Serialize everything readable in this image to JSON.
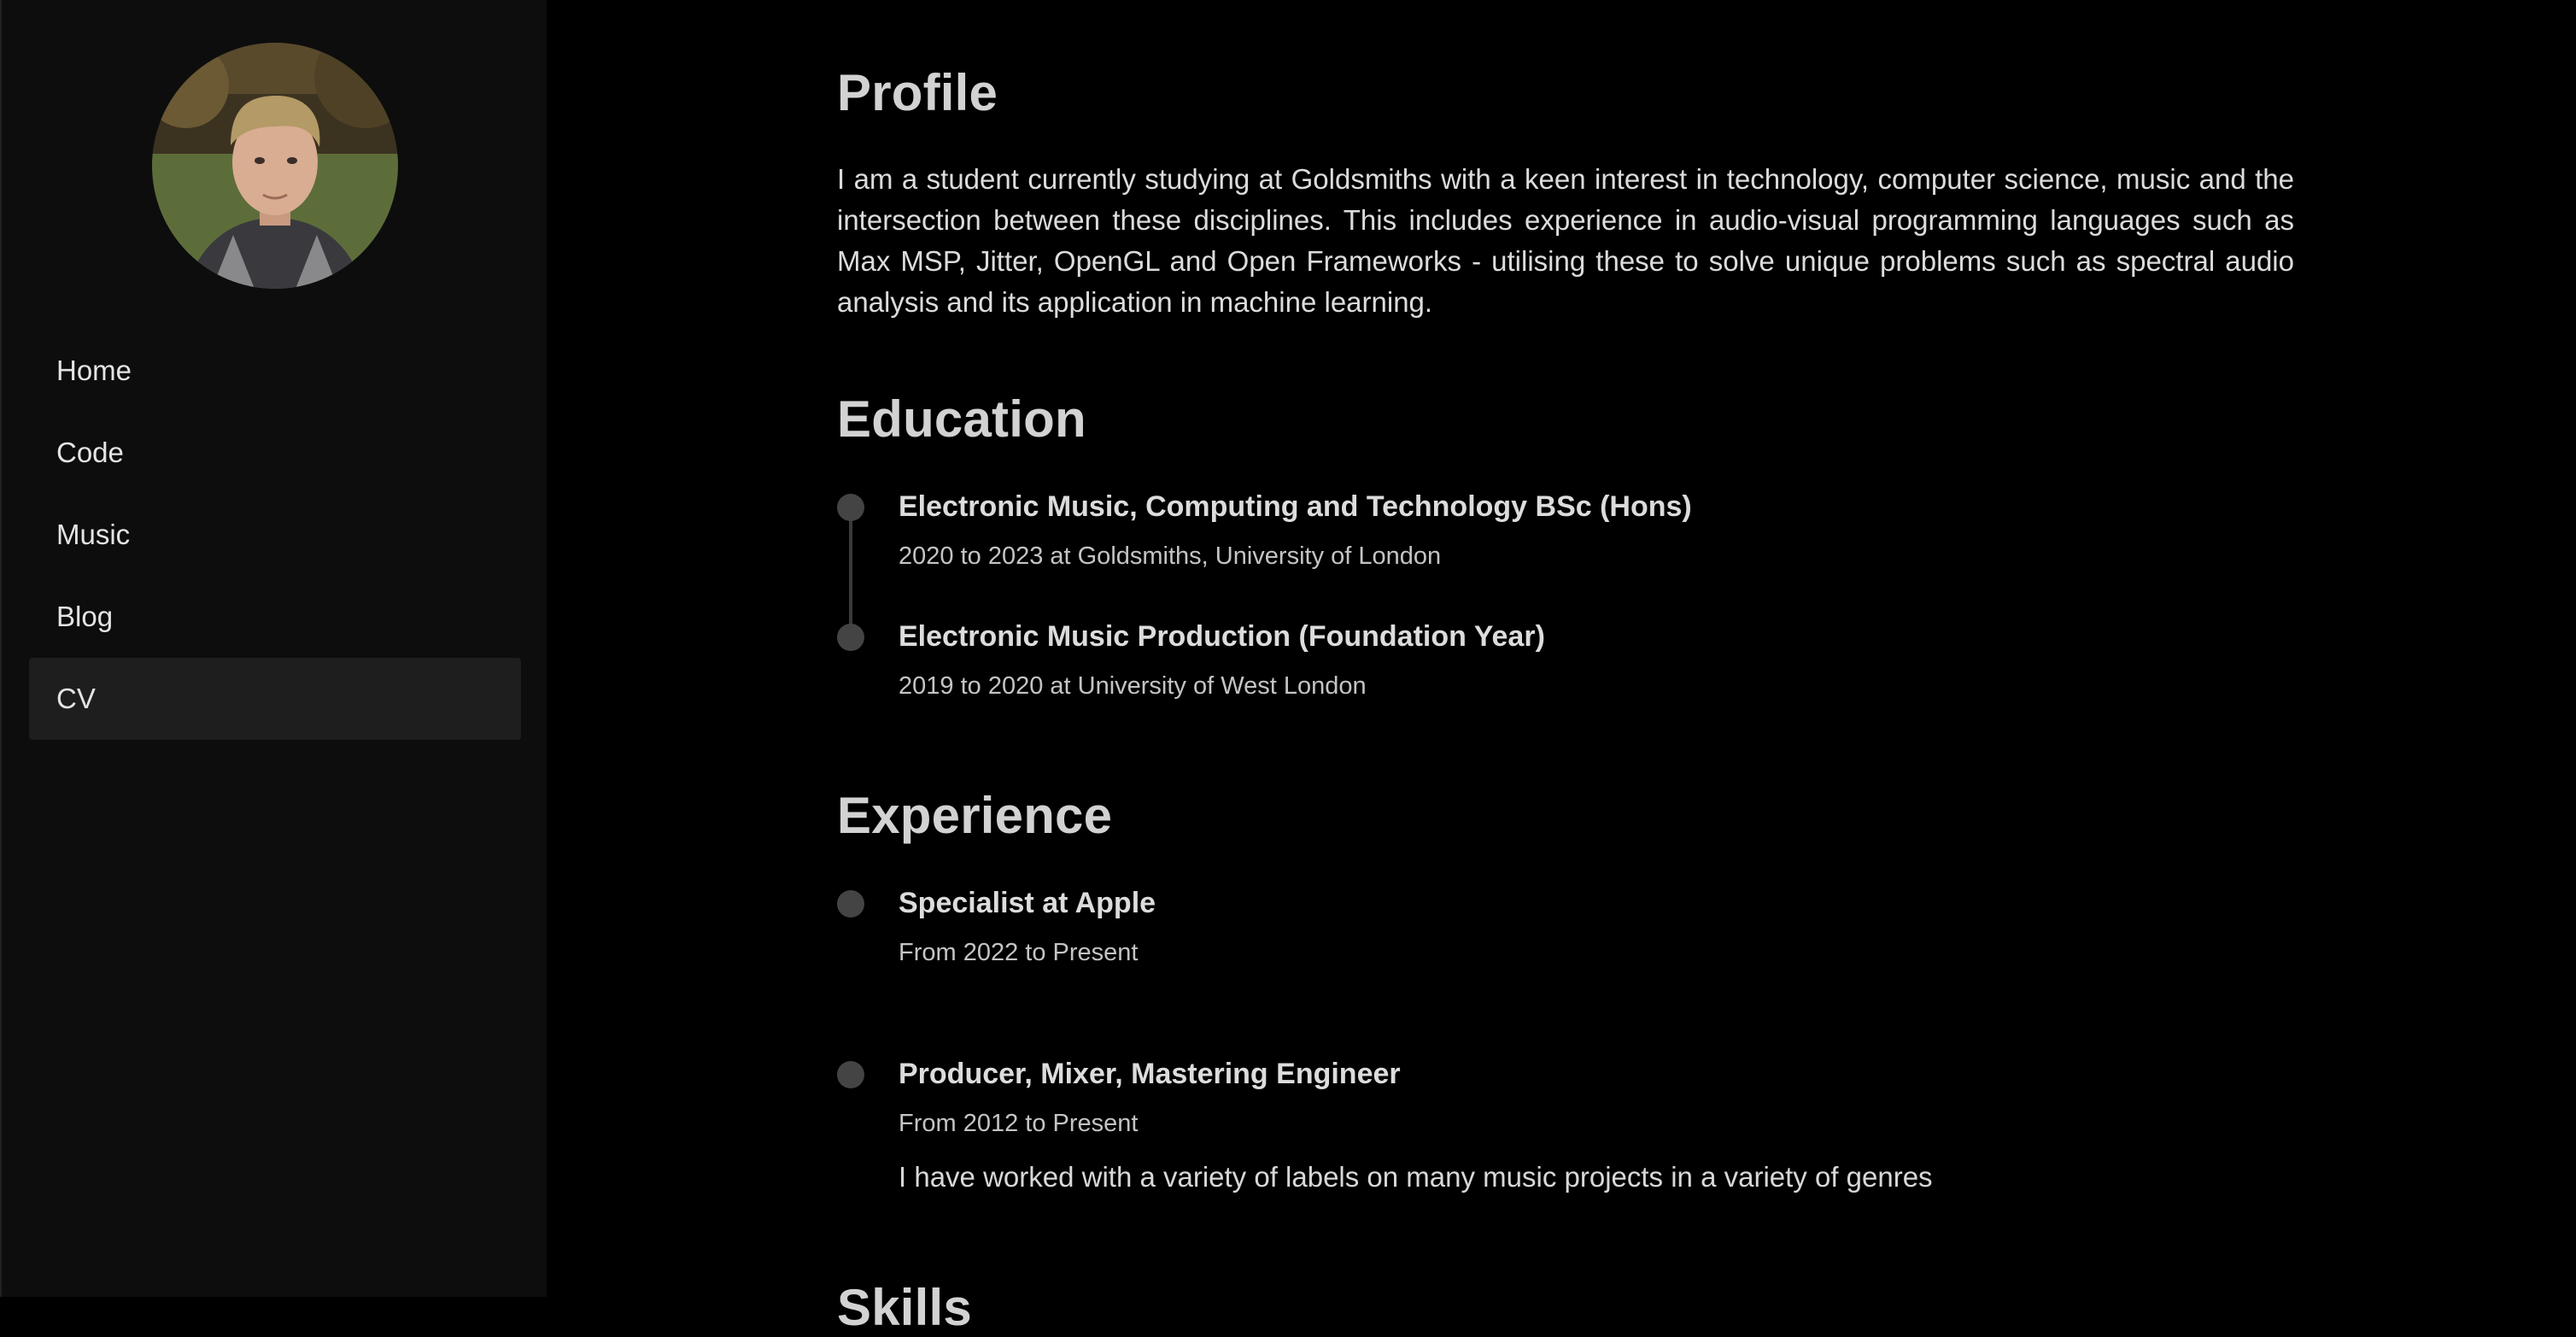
{
  "sidebar": {
    "nav": [
      {
        "label": "Home"
      },
      {
        "label": "Code"
      },
      {
        "label": "Music"
      },
      {
        "label": "Blog"
      },
      {
        "label": "CV",
        "active": true
      }
    ]
  },
  "profile": {
    "heading": "Profile",
    "text": "I am a student currently studying at Goldsmiths with a keen interest in technology, computer science, music and the intersection between these disciplines. This includes experience in audio-visual programming languages such as Max MSP, Jitter, OpenGL and Open Frameworks - utilising these to solve unique problems such as spectral audio analysis and its application in machine learning."
  },
  "education": {
    "heading": "Education",
    "items": [
      {
        "title": "Electronic Music, Computing and Technology BSc (Hons)",
        "sub": "2020 to 2023 at Goldsmiths, University of London"
      },
      {
        "title": "Electronic Music Production (Foundation Year)",
        "sub": "2019 to 2020 at University of West London"
      }
    ]
  },
  "experience": {
    "heading": "Experience",
    "items": [
      {
        "title": "Specialist at Apple",
        "sub": "From 2022 to Present"
      },
      {
        "title": "Producer, Mixer, Mastering Engineer",
        "sub": "From 2012 to Present",
        "desc": "I have worked with a variety of labels on many music projects in a variety of genres"
      }
    ]
  },
  "skills": {
    "heading": "Skills"
  },
  "colors": {
    "background": "#000000",
    "sidebar": "#0d0d0d",
    "active_nav": "#1e1e1e",
    "timeline_dot": "#444444"
  }
}
